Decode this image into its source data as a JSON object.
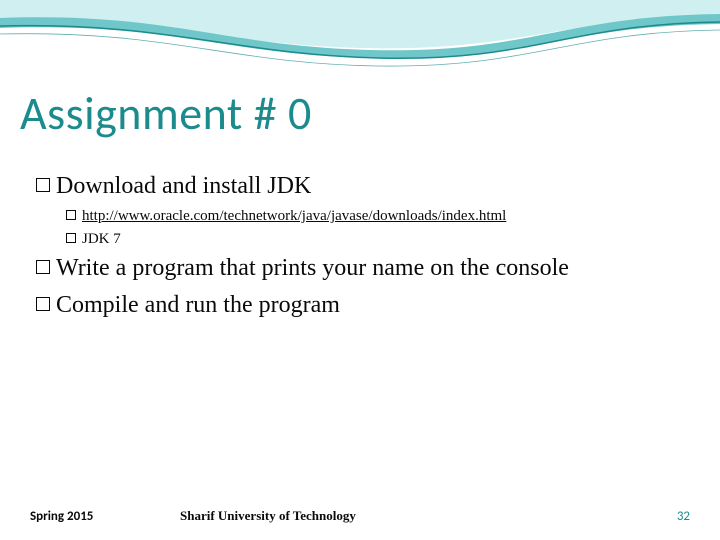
{
  "title": "Assignment # 0",
  "bullets": [
    {
      "level": 1,
      "text": "Download and install JDK"
    },
    {
      "level": 2,
      "text": "http://www.oracle.com/technetwork/java/javase/downloads/index.html",
      "link": true
    },
    {
      "level": 2,
      "text": "JDK 7"
    },
    {
      "level": 1,
      "text": "Write a program that prints your name on the console"
    },
    {
      "level": 1,
      "text": "Compile and run the program"
    }
  ],
  "footer": {
    "left": "Spring 2015",
    "center": "Sharif University of Technology",
    "right": "32"
  },
  "colors": {
    "accent": "#1c8b8e",
    "wave_light": "#cfeff0",
    "wave_mid": "#6fc7c9"
  }
}
